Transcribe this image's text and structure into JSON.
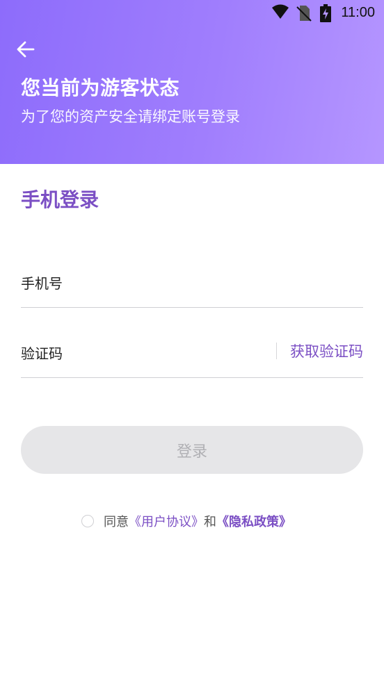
{
  "status_bar": {
    "time": "11:00",
    "icons": [
      "wifi-icon",
      "no-sim-icon",
      "battery-charging-icon"
    ]
  },
  "header": {
    "back_icon": "arrow-left-icon",
    "title": "您当前为游客状态",
    "subtitle": "为了您的资产安全请绑定账号登录",
    "gradient_colors": [
      "#8d6cfb",
      "#b596ff"
    ]
  },
  "login": {
    "section_title": "手机登录",
    "phone_placeholder": "手机号",
    "code_placeholder": "验证码",
    "get_code_label": "获取验证码",
    "submit_label": "登录"
  },
  "agreement": {
    "prefix": "同意",
    "terms_link": "《用户协议》",
    "conjunction": "和",
    "privacy_link": "《隐私政策》",
    "checked": false
  },
  "colors": {
    "accent": "#7b4fc4",
    "button_disabled_bg": "#e6e6e8",
    "button_disabled_text": "#b0b0b4"
  }
}
